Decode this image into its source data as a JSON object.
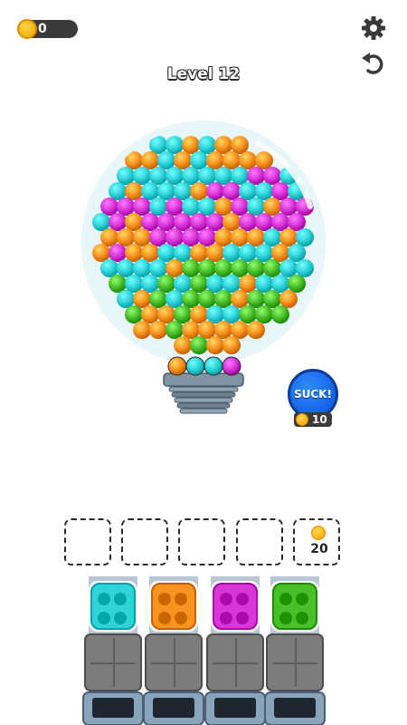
{
  "hud": {
    "coins": "0",
    "level_label": "Level 12",
    "settings_icon": "gear-icon",
    "undo_icon": "undo-icon"
  },
  "suck_button": {
    "label": "SUCK!",
    "cost": "10"
  },
  "slots": [
    {
      "locked": false
    },
    {
      "locked": false
    },
    {
      "locked": false
    },
    {
      "locked": false
    },
    {
      "locked": true,
      "cost": "20"
    }
  ],
  "palette": {
    "cyan": "#2fd3d8",
    "orange": "#f7931e",
    "magenta": "#d836d8",
    "green": "#4bbf2a"
  },
  "collectors": [
    "cyan",
    "orange",
    "magenta",
    "green"
  ],
  "queue_balls": [
    "orange",
    "cyan",
    "cyan",
    "magenta"
  ],
  "ball_bands": [
    {
      "color": "orange"
    },
    {
      "color": "cyan"
    },
    {
      "color": "magenta"
    },
    {
      "color": "orange"
    },
    {
      "color": "cyan"
    },
    {
      "color": "green"
    },
    {
      "color": "orange"
    }
  ]
}
